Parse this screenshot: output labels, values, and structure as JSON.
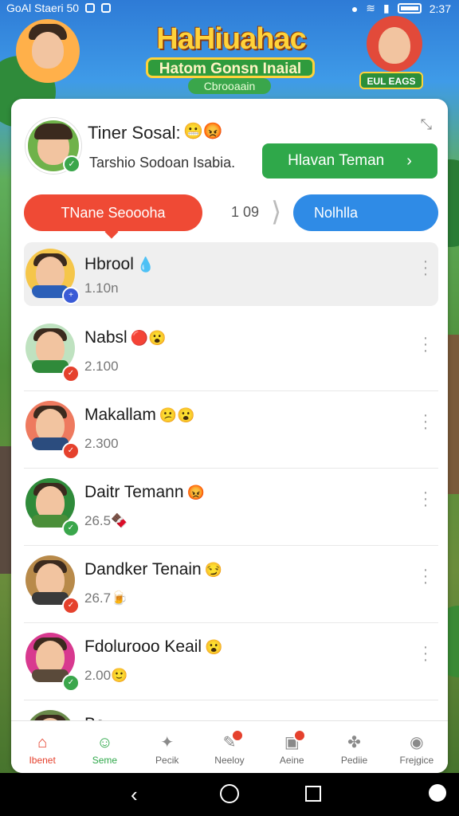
{
  "status_bar": {
    "left_text": "GoAl Staeri 50",
    "time": "2:37"
  },
  "header": {
    "title": "HaHiuahac",
    "subtitle": "Hatom Gonsn Inaial",
    "badge": "Cbrooaain",
    "right_badge": "EUL EAGS"
  },
  "profile": {
    "name": "Tiner Sosal:",
    "emoji": "😬😡",
    "subtitle": "Tarshio Sodoan Isabia.",
    "add_button_label": "Hlavan Teman",
    "add_button_chevron": "›"
  },
  "segment": {
    "left_label": "TNane Seoooha",
    "count": "1 09",
    "right_label": "Nolhlla"
  },
  "friends": [
    {
      "name": "Hbrool",
      "emoji": "💧",
      "meta": "1.10n",
      "avatar_color": "#f5c64a",
      "shirt_color": "#2b5fb8",
      "badge_color": "#3a5bd6",
      "badge_icon": "+",
      "selected": true
    },
    {
      "name": "Nabsl",
      "emoji": "🔴😮",
      "meta": "2.100",
      "avatar_color": "#bfe2c0",
      "shirt_color": "#2f8a3a",
      "badge_color": "#e5412d",
      "badge_icon": "✓",
      "selected": false
    },
    {
      "name": "Makallam",
      "emoji": "😕😮",
      "meta": "2.300",
      "avatar_color": "#ee7a5f",
      "shirt_color": "#2b4c7e",
      "badge_color": "#e5412d",
      "badge_icon": "✓",
      "selected": false
    },
    {
      "name": "Daitr Temann",
      "emoji": "😡",
      "meta": "26.5🍫",
      "avatar_color": "#2f8b3a",
      "shirt_color": "#4b8f3a",
      "badge_color": "#3aa64b",
      "badge_icon": "✓",
      "selected": false
    },
    {
      "name": "Dandker Tenain",
      "emoji": "😏",
      "meta": "26.7🍺",
      "avatar_color": "#b88a4a",
      "shirt_color": "#3a3a3a",
      "badge_color": "#e5412d",
      "badge_icon": "✓",
      "selected": false
    },
    {
      "name": "Fdolurooo Keail",
      "emoji": "😮",
      "meta": "2.00🙂",
      "avatar_color": "#d8398f",
      "shirt_color": "#5a4a3a",
      "badge_color": "#3aa64b",
      "badge_icon": "✓",
      "selected": false
    },
    {
      "name": "Ba...",
      "emoji": "",
      "meta": "",
      "avatar_color": "#6a8a4a",
      "shirt_color": "#3a3a3a",
      "badge_color": "#3aa64b",
      "badge_icon": "✓",
      "selected": false
    }
  ],
  "bottom_nav": [
    {
      "label": "Ibenet",
      "icon": "home-icon"
    },
    {
      "label": "Seme",
      "icon": "smile-icon"
    },
    {
      "label": "Pecik",
      "icon": "badge-icon"
    },
    {
      "label": "Neeloy",
      "icon": "elephant-icon"
    },
    {
      "label": "Aeine",
      "icon": "chat-icon"
    },
    {
      "label": "Pediie",
      "icon": "puzzle-icon"
    },
    {
      "label": "Frejgice",
      "icon": "person-icon"
    }
  ],
  "colors": {
    "primary_red": "#ef4a35",
    "primary_green": "#2fa84a",
    "primary_blue": "#2f8be6"
  }
}
